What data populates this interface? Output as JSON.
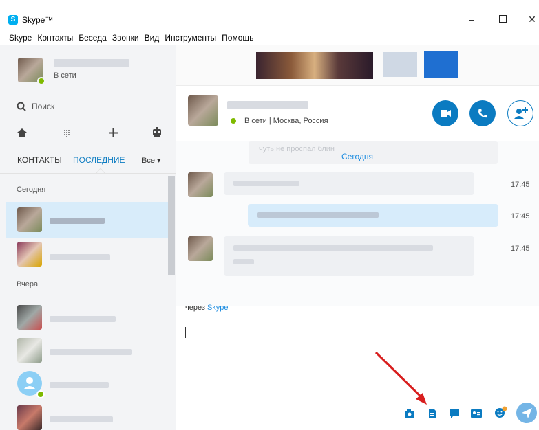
{
  "window": {
    "title": "Skype™",
    "logo_letter": "S"
  },
  "menu": [
    "Skype",
    "Контакты",
    "Беседа",
    "Звонки",
    "Вид",
    "Инструменты",
    "Помощь"
  ],
  "profile": {
    "status": "В сети"
  },
  "search": {
    "label": "Поиск"
  },
  "tabs": {
    "contacts": "КОНТАКТЫ",
    "recent": "ПОСЛЕДНИЕ",
    "filter": "Все"
  },
  "groups": {
    "today": "Сегодня",
    "yesterday": "Вчера"
  },
  "chat_header": {
    "status": "В сети | Москва, Россия"
  },
  "conversation": {
    "date_label": "Сегодня",
    "faded_text": "чуть не проспал блин",
    "messages": [
      {
        "time": "17:45"
      },
      {
        "time": "17:45"
      },
      {
        "time": "17:45"
      }
    ]
  },
  "compose": {
    "via_label": "через",
    "via_link": "Skype"
  },
  "colors": {
    "accent": "#0b7bc1",
    "online": "#7fba00",
    "selected": "#d8ecfa",
    "link": "#1a8be0",
    "arrow": "#d81e1e"
  }
}
